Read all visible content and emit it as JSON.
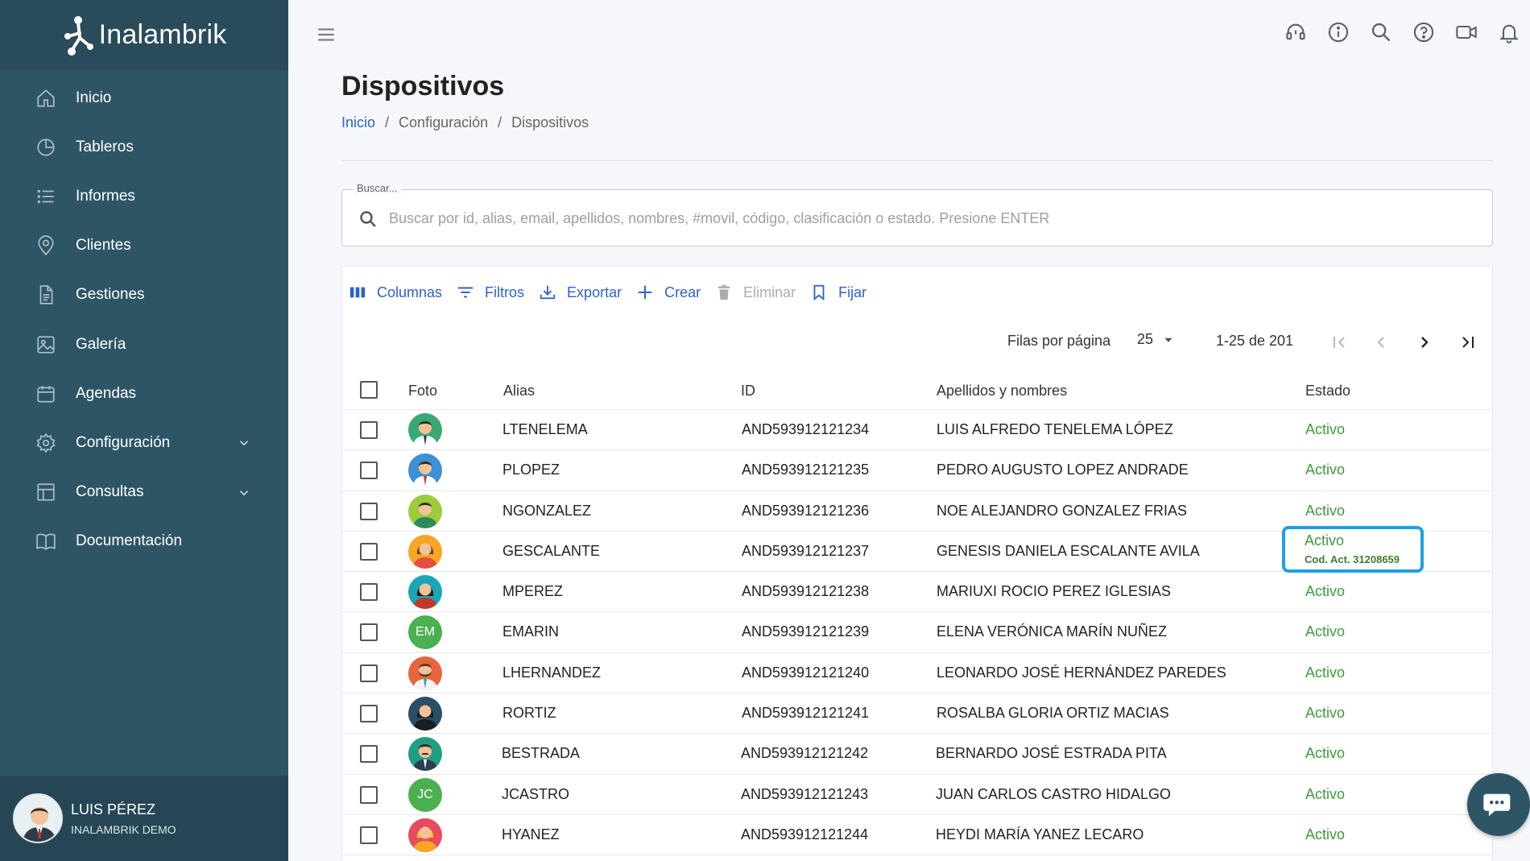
{
  "app": {
    "logo_text": "Inalambrik"
  },
  "sidebar": {
    "items": [
      {
        "label": "Inicio"
      },
      {
        "label": "Tableros"
      },
      {
        "label": "Informes"
      },
      {
        "label": "Clientes"
      },
      {
        "label": "Gestiones"
      },
      {
        "label": "Galería"
      },
      {
        "label": "Agendas"
      },
      {
        "label": "Configuración"
      },
      {
        "label": "Consultas"
      },
      {
        "label": "Documentación"
      }
    ],
    "user": {
      "name": "LUIS PÉREZ",
      "org": "INALAMBRIK DEMO"
    }
  },
  "page": {
    "title": "Dispositivos",
    "breadcrumb": [
      "Inicio",
      "Configuración",
      "Dispositivos"
    ],
    "breadcrumb_sep": "/"
  },
  "search": {
    "label": "Buscar...",
    "placeholder": "Buscar por id, alias, email, apellidos, nombres, #movil, código, clasificación o estado. Presione ENTER",
    "value": ""
  },
  "toolbar": {
    "columns": "Columnas",
    "filters": "Filtros",
    "export": "Exportar",
    "create": "Crear",
    "delete": "Eliminar",
    "pin": "Fijar"
  },
  "pagination": {
    "rows_per_page_label": "Filas por página",
    "rows_per_page": "25",
    "range": "1-25 de 201"
  },
  "table": {
    "headers": {
      "photo": "Foto",
      "alias": "Alias",
      "id": "ID",
      "name": "Apellidos y nombres",
      "status": "Estado"
    },
    "rows": [
      {
        "alias": "LTENELEMA",
        "id": "AND593912121234",
        "name": "LUIS ALFREDO TENELEMA LÓPEZ",
        "status": "Activo",
        "avatar": "man-green-icon"
      },
      {
        "alias": "PLOPEZ",
        "id": "AND593912121235",
        "name": "PEDRO AUGUSTO LOPEZ ANDRADE",
        "status": "Activo",
        "avatar": "man-blue-icon"
      },
      {
        "alias": "NGONZALEZ",
        "id": "AND593912121236",
        "name": "NOE ALEJANDRO GONZALEZ FRIAS",
        "status": "Activo",
        "avatar": "man-lime-icon"
      },
      {
        "alias": "GESCALANTE",
        "id": "AND593912121237",
        "name": "GENESIS DANIELA ESCALANTE AVILA",
        "status": "Activo",
        "status_note": "Cod. Act. 31208659",
        "avatar": "woman-orange-icon"
      },
      {
        "alias": "MPEREZ",
        "id": "AND593912121238",
        "name": "MARIUXI ROCIO PEREZ IGLESIAS",
        "status": "Activo",
        "avatar": "woman-teal-icon"
      },
      {
        "alias": "EMARIN",
        "id": "AND593912121239",
        "name": "ELENA VERÓNICA MARÍN NUÑEZ",
        "status": "Activo",
        "initials": "EM"
      },
      {
        "alias": "LHERNANDEZ",
        "id": "AND593912121240",
        "name": "LEONARDO JOSÉ HERNÁNDEZ PAREDES",
        "status": "Activo",
        "avatar": "man-beard-orange-icon"
      },
      {
        "alias": "RORTIZ",
        "id": "AND593912121241",
        "name": "ROSALBA GLORIA ORTIZ MACIAS",
        "status": "Activo",
        "avatar": "woman-dark-icon"
      },
      {
        "alias": "BESTRADA",
        "id": "AND593912121242",
        "name": "BERNARDO JOSÉ ESTRADA PITA",
        "status": "Activo",
        "avatar": "man-mustache-teal-icon"
      },
      {
        "alias": "JCASTRO",
        "id": "AND593912121243",
        "name": "JUAN CARLOS CASTRO HIDALGO",
        "status": "Activo",
        "initials": "JC"
      },
      {
        "alias": "HYANEZ",
        "id": "AND593912121244",
        "name": "HEYDI MARÍA YANEZ LECARO",
        "status": "Activo",
        "avatar": "woman-red-icon"
      }
    ]
  },
  "colors": {
    "sidebar": "#2e5566",
    "accent": "#2f62c8",
    "active": "#3f9b3a",
    "highlight": "#1ea0e6"
  }
}
